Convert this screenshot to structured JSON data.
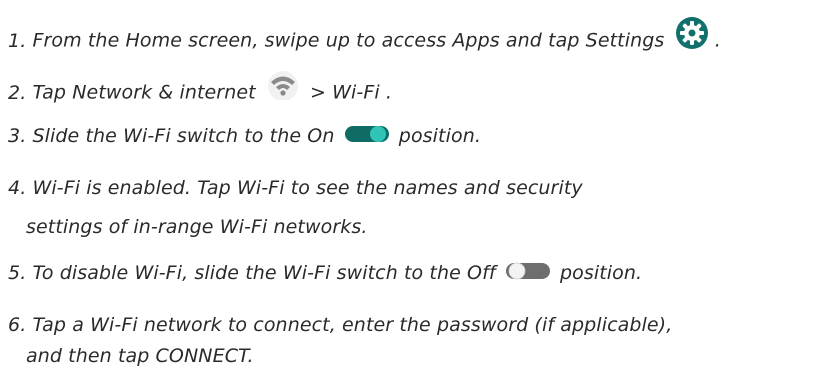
{
  "steps": [
    {
      "number": "1.",
      "text_before": "From the Home screen, swipe up to access Apps and tap Settings",
      "icon": "settings-gear-icon",
      "text_after": " ."
    },
    {
      "number": "2.",
      "text_before": "Tap Network & internet",
      "icon": "wifi-icon",
      "text_after": "> Wi-Fi ."
    },
    {
      "number": "3.",
      "text_before": "Slide the Wi-Fi switch to the On",
      "icon": "toggle-on-icon",
      "text_after": "position."
    },
    {
      "number": "4.",
      "line1": "Wi-Fi is enabled. Tap Wi-Fi to see the names and security",
      "line2": "settings of in-range Wi-Fi networks."
    },
    {
      "number": "5.",
      "text_before": "To disable Wi-Fi, slide the Wi-Fi switch to the Off",
      "icon": "toggle-off-icon",
      "text_after": "position."
    },
    {
      "number": "6.",
      "line1": "Tap a Wi-Fi network to connect, enter the password (if applicable),",
      "line2": "and then tap CONNECT."
    }
  ],
  "colors": {
    "text": "#2a2a2a",
    "gear_bg": "#11706b",
    "toggle_on_track": "#0f6b66",
    "toggle_off_track": "#6e6e6e",
    "wifi_icon": "#8a8a8a"
  }
}
